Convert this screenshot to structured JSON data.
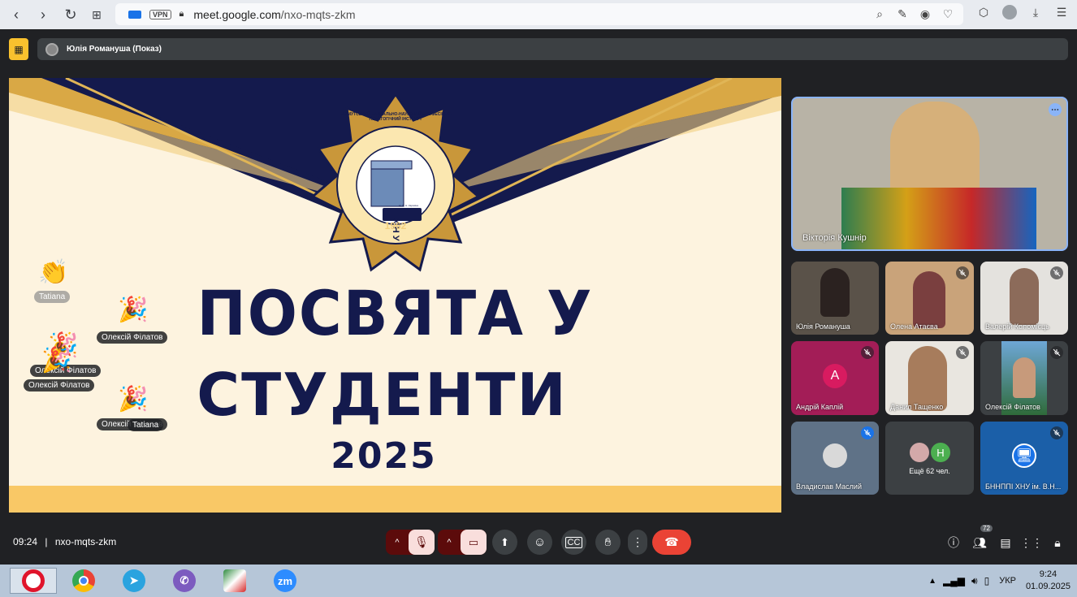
{
  "browser": {
    "url_host": "meet.google.com",
    "url_path": "/nxo-mqts-zkm",
    "vpn_label": "VPN"
  },
  "meet": {
    "presenter_label": "Юлія Романуша (Показ)",
    "slide": {
      "title_line1": "ПОСВЯТА У",
      "title_line2": "СТУДЕНТИ",
      "year": "2025",
      "logo_ring_text": "БАХМУТСЬКИЙ НАВЧАЛЬНО-НАУКОВИЙ ПРОФЕСІЙНО-ПЕДАГОГІЧНИЙ ІНСТИТУТ",
      "logo_letters": "ХНУ",
      "logo_sub": "ім. В. Н. Каразіна",
      "logo_year": "1962"
    },
    "reactions": [
      {
        "emoji": "👏",
        "label": "Tatiana"
      },
      {
        "emoji": "🎉",
        "label": "Олексій Філатов"
      },
      {
        "emoji": "🎉",
        "label": "Олексій Філатов"
      },
      {
        "emoji": "🎉",
        "label": "Олексій Філатов"
      },
      {
        "emoji": "🎉",
        "label": "Олексій Філатов"
      },
      {
        "emoji": "👏",
        "label": "Tatiana"
      }
    ],
    "participants": {
      "main": {
        "name": "Вікторія Кушнір"
      },
      "tiles": [
        {
          "name": "Юлія Романуша"
        },
        {
          "name": "Олена Атаєва"
        },
        {
          "name": "Валерій Коломієць"
        },
        {
          "name": "Андрій Каплій",
          "initial": "А"
        },
        {
          "name": "Данил Тащенко"
        },
        {
          "name": "Олексій Філатов"
        },
        {
          "name": "Владислав Маслий"
        },
        {
          "name": "Ещё 62 чел.",
          "initial": "Н"
        },
        {
          "name": "БННППІ ХНУ ім. В.Н..."
        }
      ]
    },
    "bottom": {
      "time": "09:24",
      "separator": "|",
      "meeting_code": "nxo-mqts-zkm",
      "participants_count": "72"
    }
  },
  "taskbar": {
    "apps": [
      "opera-icon",
      "chrome-icon",
      "telegram-icon",
      "viber-icon",
      "app-icon",
      "zoom-icon"
    ],
    "zoom_label": "zm",
    "lang": "УКР",
    "clock_time": "9:24",
    "clock_date": "01.09.2025"
  },
  "colors": {
    "slide_bg": "#fdf3df",
    "slide_navy": "#141a4d",
    "gold": "#d9a845",
    "accent_blue": "#8ab4f8",
    "end_call": "#ea4335",
    "present_yellow": "#f9c12e"
  }
}
